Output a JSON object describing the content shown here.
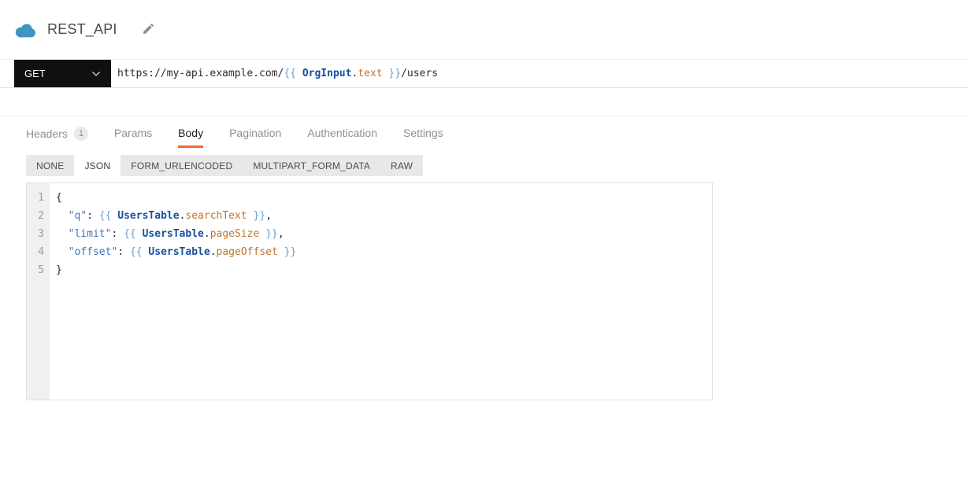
{
  "header": {
    "title": "REST_API"
  },
  "request": {
    "method": "GET",
    "url_segments": [
      {
        "t": "https://my-api.example.com/",
        "c": "plain"
      },
      {
        "t": "{{ ",
        "c": "brace"
      },
      {
        "t": "OrgInput",
        "c": "entity"
      },
      {
        "t": ".",
        "c": "plain"
      },
      {
        "t": "text",
        "c": "property"
      },
      {
        "t": " }}",
        "c": "brace"
      },
      {
        "t": "/users",
        "c": "plain"
      }
    ]
  },
  "tabs": [
    {
      "label": "Headers",
      "badge": "1",
      "active": false
    },
    {
      "label": "Params",
      "active": false
    },
    {
      "label": "Body",
      "active": true
    },
    {
      "label": "Pagination",
      "active": false
    },
    {
      "label": "Authentication",
      "active": false
    },
    {
      "label": "Settings",
      "active": false
    }
  ],
  "body_type_tabs": [
    {
      "label": "NONE",
      "active": false
    },
    {
      "label": "JSON",
      "active": true
    },
    {
      "label": "FORM_URLENCODED",
      "active": false
    },
    {
      "label": "MULTIPART_FORM_DATA",
      "active": false
    },
    {
      "label": "RAW",
      "active": false
    }
  ],
  "editor": {
    "lines": [
      {
        "n": "1",
        "segments": [
          {
            "t": "{",
            "c": "plain"
          }
        ]
      },
      {
        "n": "2",
        "segments": [
          {
            "t": "  ",
            "c": "plain"
          },
          {
            "t": "\"q\"",
            "c": "key"
          },
          {
            "t": ": ",
            "c": "plain"
          },
          {
            "t": "{{ ",
            "c": "brace"
          },
          {
            "t": "UsersTable",
            "c": "entity"
          },
          {
            "t": ".",
            "c": "plain"
          },
          {
            "t": "searchText",
            "c": "property"
          },
          {
            "t": " }}",
            "c": "brace"
          },
          {
            "t": ",",
            "c": "plain"
          }
        ]
      },
      {
        "n": "3",
        "segments": [
          {
            "t": "  ",
            "c": "plain"
          },
          {
            "t": "\"limit\"",
            "c": "key"
          },
          {
            "t": ": ",
            "c": "plain"
          },
          {
            "t": "{{ ",
            "c": "brace"
          },
          {
            "t": "UsersTable",
            "c": "entity"
          },
          {
            "t": ".",
            "c": "plain"
          },
          {
            "t": "pageSize",
            "c": "property"
          },
          {
            "t": " }}",
            "c": "brace"
          },
          {
            "t": ",",
            "c": "plain"
          }
        ]
      },
      {
        "n": "4",
        "segments": [
          {
            "t": "  ",
            "c": "plain"
          },
          {
            "t": "\"offset\"",
            "c": "key"
          },
          {
            "t": ": ",
            "c": "plain"
          },
          {
            "t": "{{ ",
            "c": "brace"
          },
          {
            "t": "UsersTable",
            "c": "entity"
          },
          {
            "t": ".",
            "c": "plain"
          },
          {
            "t": "pageOffset",
            "c": "property"
          },
          {
            "t": " }}",
            "c": "brace"
          }
        ]
      },
      {
        "n": "5",
        "segments": [
          {
            "t": "}",
            "c": "plain"
          }
        ]
      }
    ]
  },
  "icons": {
    "datasource": "cloud-icon",
    "edit": "pencil-icon",
    "method_dropdown": "chevron-down-icon"
  },
  "colors": {
    "accent_orange": "#F3682F",
    "method_bg": "#101010",
    "cloud_blue": "#4193C1",
    "entity_blue": "#17509E",
    "property_orange": "#C0752A",
    "key_blue": "#4273BD",
    "brace_blue": "#6CA1D8",
    "plain_code": "#2B2B2B"
  }
}
